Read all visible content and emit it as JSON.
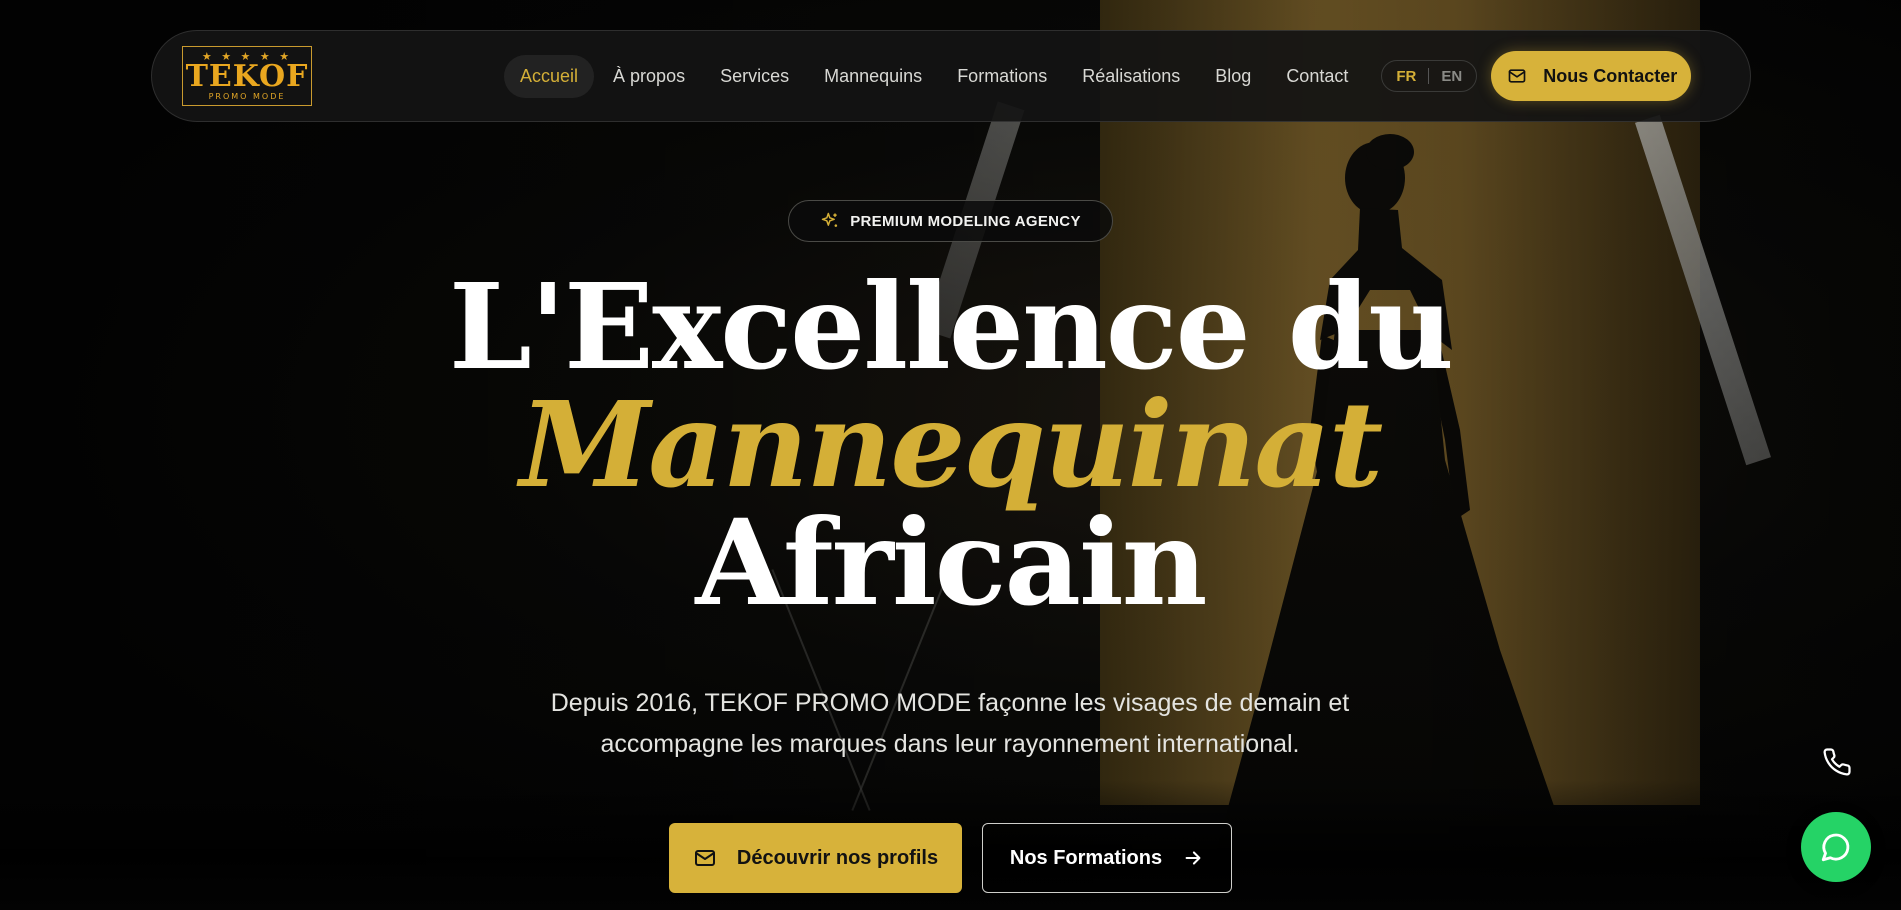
{
  "brand": {
    "name": "TEKOF",
    "subtitle": "PROMO MODE",
    "stars": "★ ★ ★ ★ ★",
    "color": "#e9a71f"
  },
  "nav": {
    "items": [
      {
        "label": "Accueil",
        "active": true
      },
      {
        "label": "À propos",
        "active": false
      },
      {
        "label": "Services",
        "active": false
      },
      {
        "label": "Mannequins",
        "active": false
      },
      {
        "label": "Formations",
        "active": false
      },
      {
        "label": "Réalisations",
        "active": false
      },
      {
        "label": "Blog",
        "active": false
      },
      {
        "label": "Contact",
        "active": false
      }
    ],
    "lang": {
      "fr": "FR",
      "en": "EN",
      "active": "FR"
    },
    "contact_button": {
      "label": "Nous Contacter",
      "icon": "mail-icon"
    }
  },
  "hero": {
    "badge": {
      "label": "PREMIUM MODELING AGENCY",
      "icon": "sparkles-icon"
    },
    "headline": {
      "line1": "L'Excellence du",
      "line2": "Mannequinat",
      "line3": "Africain"
    },
    "subtitle_line1": "Depuis 2016, TEKOF PROMO MODE façonne les visages de demain et",
    "subtitle_line2": "accompagne les marques dans leur rayonnement international.",
    "primary_cta": {
      "label": "Découvrir nos profils",
      "icon": "mail-icon"
    },
    "secondary_cta": {
      "label": "Nos Formations",
      "icon": "arrow-right-icon"
    }
  },
  "floating": {
    "phone_icon": "phone-icon",
    "whatsapp_icon": "whatsapp-icon"
  },
  "colors": {
    "accent_gold": "#d4af37",
    "button_gold": "#d7b23a",
    "whatsapp_green": "#25d366",
    "background": "#050505"
  }
}
